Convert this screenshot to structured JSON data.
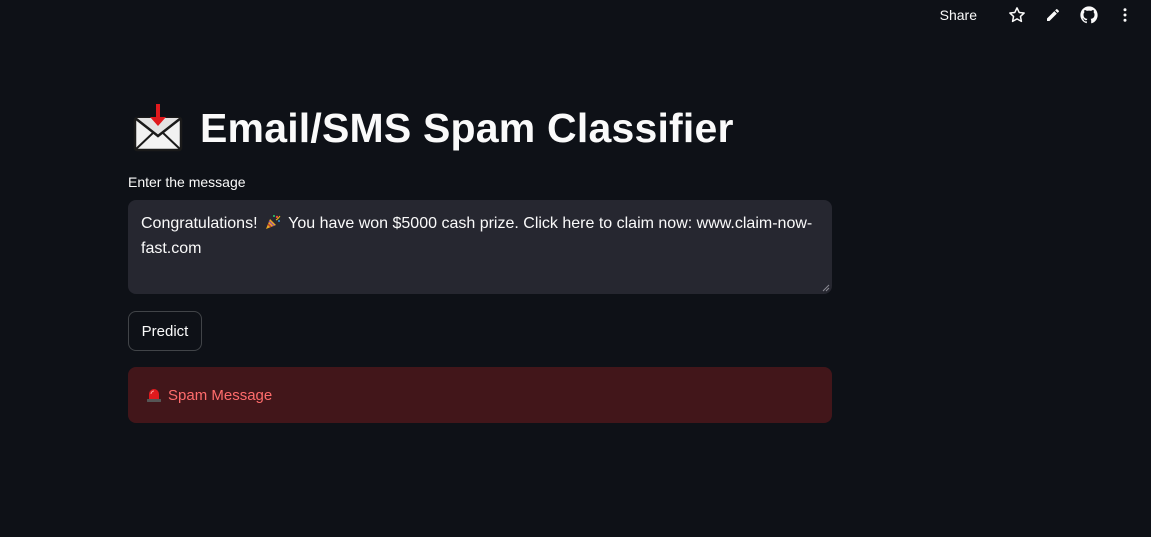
{
  "toolbar": {
    "share_label": "Share",
    "icons": [
      "star-icon",
      "pencil-icon",
      "github-icon",
      "more-vertical-icon"
    ]
  },
  "app": {
    "title_icon": "incoming-envelope-icon",
    "title": "Email/SMS Spam Classifier"
  },
  "message_input": {
    "label": "Enter the message",
    "value_before_emoji": "Congratulations!",
    "emoji": "party-popper-icon",
    "value_after_emoji": "You have won $5000 cash prize. Click here to claim now: www.claim-now-fast.com"
  },
  "predict_button": {
    "label": "Predict"
  },
  "result": {
    "icon": "rotating-light-icon",
    "text": "Spam Message",
    "color": "#ff6c6c",
    "background": "#3e2327"
  },
  "colors": {
    "background": "#0e1117",
    "input_background": "#262730",
    "text": "#fafafa"
  }
}
